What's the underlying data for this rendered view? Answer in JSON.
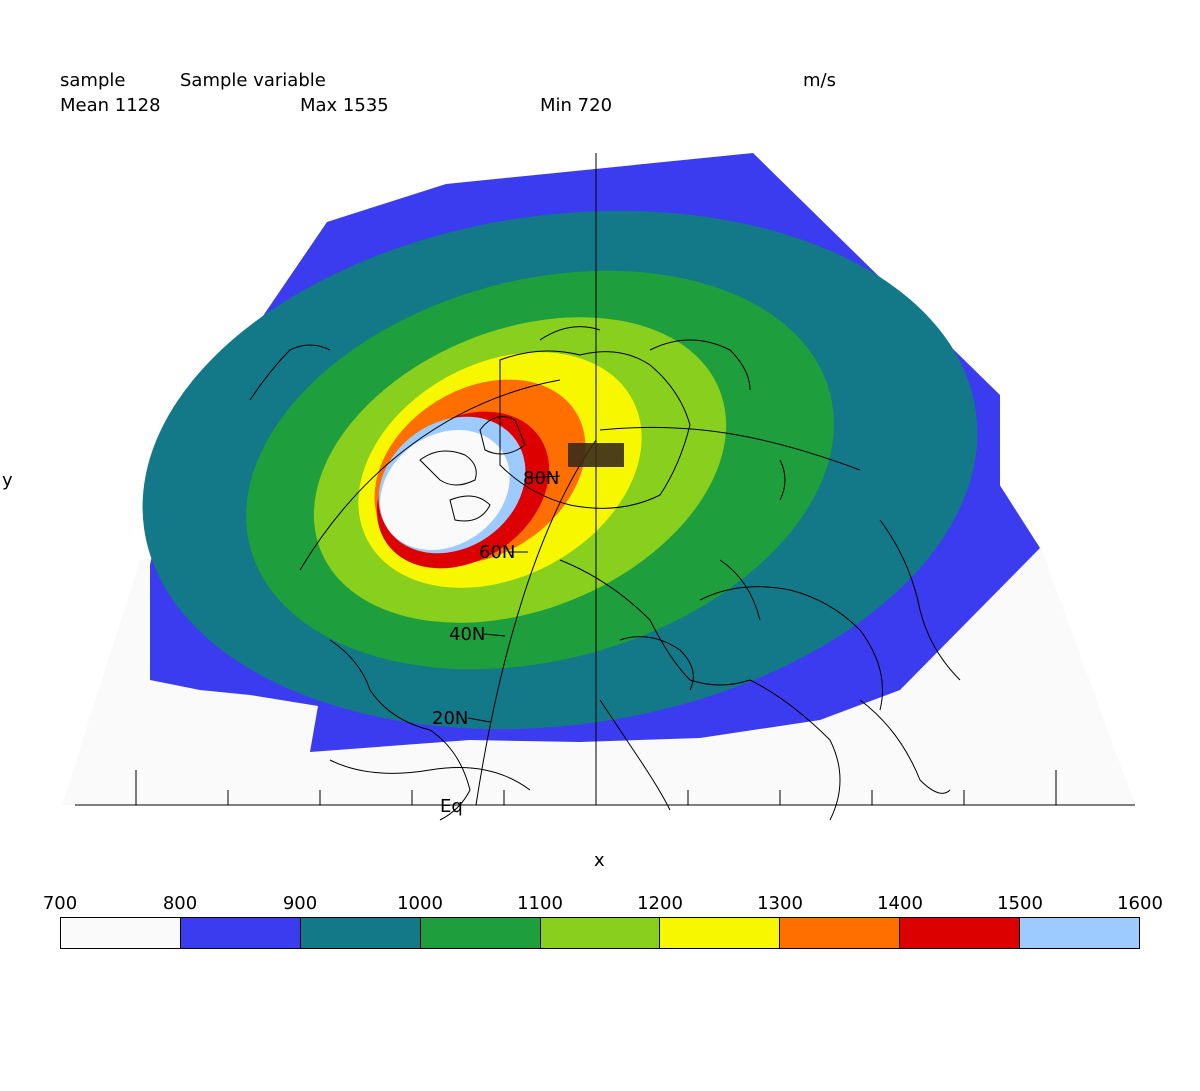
{
  "header": {
    "name": "sample",
    "long_name": "Sample variable",
    "units": "m/s",
    "mean_text": "Mean 1128",
    "max_text": "Max 1535",
    "min_text": "Min 720"
  },
  "axes": {
    "xlabel": "x",
    "ylabel": "y"
  },
  "graticule": {
    "latitude_labels": [
      "80N",
      "60N",
      "40N",
      "20N",
      "Eq"
    ]
  },
  "map": {
    "projection": "polar-oblique",
    "center": "North Pole",
    "coastlines": true
  },
  "colorbar": {
    "ticks": [
      "700",
      "800",
      "900",
      "1000",
      "1100",
      "1200",
      "1300",
      "1400",
      "1500",
      "1600"
    ],
    "colors": [
      "#fafafa",
      "#3b3bef",
      "#137888",
      "#1e9e3c",
      "#88cf1e",
      "#f7f700",
      "#ff6f00",
      "#dd0000",
      "#9ecbff"
    ]
  },
  "chart_data": {
    "type": "heatmap",
    "title": "Sample variable",
    "units": "m/s",
    "mean": 1128,
    "max": 1535,
    "min": 720,
    "levels": [
      700,
      800,
      900,
      1000,
      1100,
      1200,
      1300,
      1400,
      1500,
      1600
    ],
    "xlabel": "x",
    "ylabel": "y"
  }
}
